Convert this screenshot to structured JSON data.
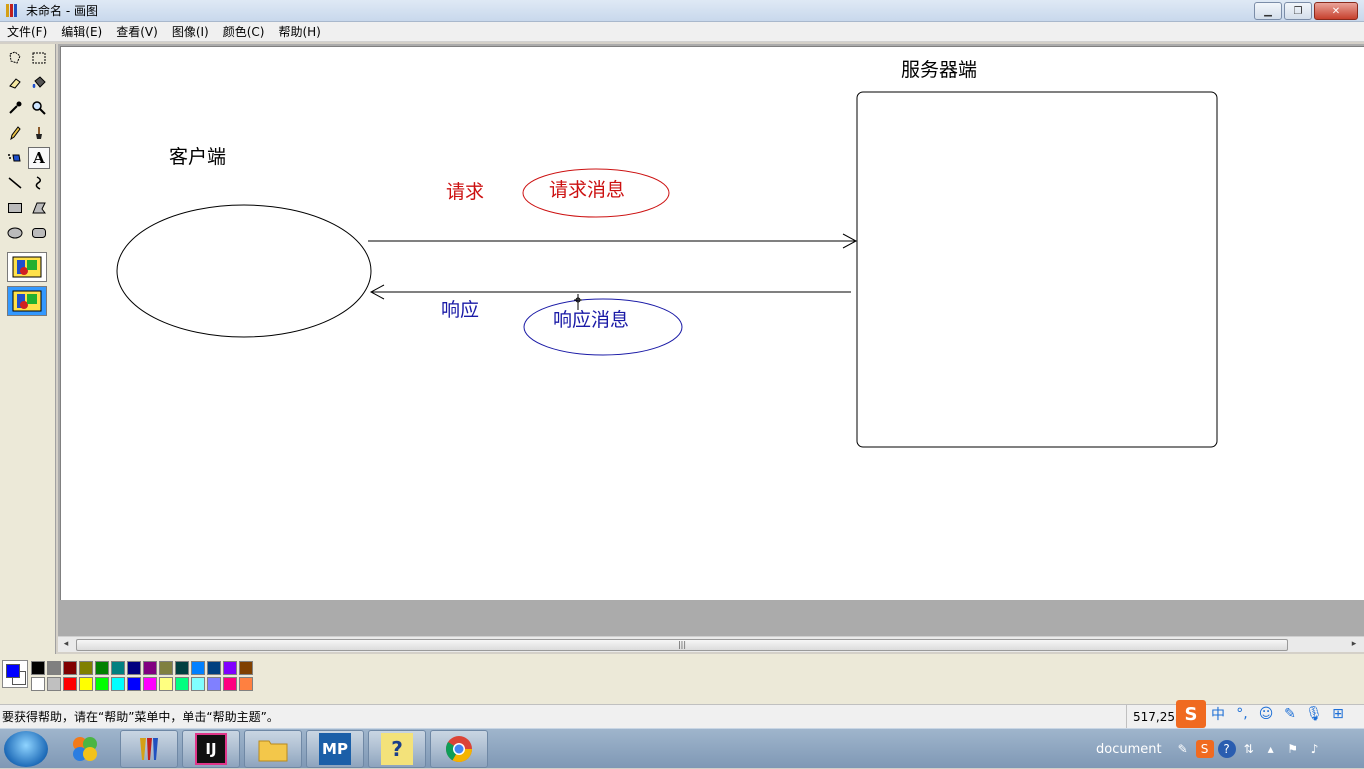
{
  "window": {
    "title": "未命名 - 画图",
    "minimize_glyph": "▁",
    "restore_glyph": "❐",
    "close_glyph": "✕"
  },
  "menu": [
    "文件(F)",
    "编辑(E)",
    "查看(V)",
    "图像(I)",
    "颜色(C)",
    "帮助(H)"
  ],
  "tools": [
    {
      "name": "free-select-icon"
    },
    {
      "name": "rect-select-icon"
    },
    {
      "name": "eraser-icon"
    },
    {
      "name": "fill-icon"
    },
    {
      "name": "color-picker-icon"
    },
    {
      "name": "magnifier-icon"
    },
    {
      "name": "pencil-icon"
    },
    {
      "name": "brush-icon"
    },
    {
      "name": "airbrush-icon"
    },
    {
      "name": "text-icon",
      "active": true
    },
    {
      "name": "line-icon"
    },
    {
      "name": "curve-icon"
    },
    {
      "name": "rectangle-icon"
    },
    {
      "name": "polygon-icon"
    },
    {
      "name": "ellipse-icon"
    },
    {
      "name": "rounded-rect-icon"
    }
  ],
  "text_tool_glyph": "A",
  "drawing": {
    "client_label": "客户端",
    "server_label": "服务器端",
    "request_label": "请求",
    "request_message": "请求消息",
    "response_label": "响应",
    "response_message": "响应消息",
    "request_color": "#cc1111",
    "response_color": "#1a1aa6"
  },
  "scrollbar": {
    "left_arrow": "◂",
    "right_arrow": "▸",
    "grip": "|||"
  },
  "colors": {
    "foreground": "#0000ff",
    "background": "#ffffff",
    "palette_top": [
      "#000000",
      "#808080",
      "#800000",
      "#808000",
      "#008000",
      "#008080",
      "#000080",
      "#800080",
      "#808040",
      "#004040",
      "#0080ff",
      "#004080",
      "#8000ff",
      "#804000"
    ],
    "palette_bottom": [
      "#ffffff",
      "#c0c0c0",
      "#ff0000",
      "#ffff00",
      "#00ff00",
      "#00ffff",
      "#0000ff",
      "#ff00ff",
      "#ffff80",
      "#00ff80",
      "#80ffff",
      "#8080ff",
      "#ff0080",
      "#ff8040"
    ]
  },
  "status": {
    "help_text": "要获得帮助，请在“帮助”菜单中，单击“帮助主题”。",
    "coordinates": "517,253"
  },
  "ime": {
    "logo": "S",
    "items": [
      "中",
      "°,",
      "☺",
      "✎",
      "🎙",
      "⊞"
    ]
  },
  "taskbar": {
    "apps": [
      {
        "name": "paint-icon",
        "label": ""
      },
      {
        "name": "intellij-icon",
        "label": "IJ"
      },
      {
        "name": "explorer-icon",
        "label": ""
      },
      {
        "name": "mp-app-icon",
        "label": "MP"
      },
      {
        "name": "help-app-icon",
        "label": "?"
      },
      {
        "name": "chrome-icon",
        "label": ""
      }
    ],
    "tray_label": "document"
  }
}
